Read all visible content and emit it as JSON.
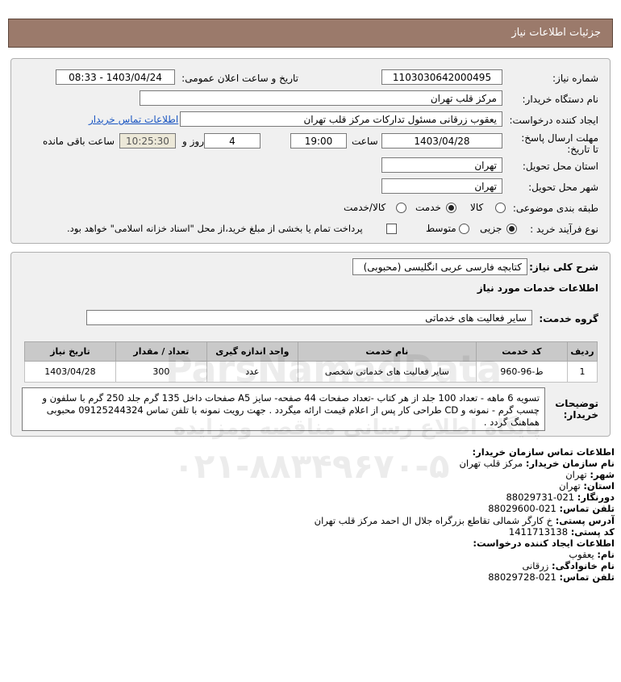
{
  "header": {
    "title": "جزئیات اطلاعات نیاز"
  },
  "need_number": {
    "label": "شماره نیاز:",
    "value": "1103030642000495"
  },
  "announce": {
    "label": "تاریخ و ساعت اعلان عمومی:",
    "value": "1403/04/24 - 08:33"
  },
  "buyer_org": {
    "label": "نام دستگاه خریدار:",
    "value": "مرکز قلب تهران"
  },
  "creator": {
    "label": "ایجاد کننده درخواست:",
    "value": "یعقوب زرقانی مسئول تدارکات مرکز قلب تهران",
    "contact_link": "اطلاعات تماس خریدار"
  },
  "deadline": {
    "label": "مهلت ارسال پاسخ: تا تاریخ:",
    "date": "1403/04/28",
    "time_label": "ساعت",
    "time": "19:00",
    "days": "4",
    "days_label": "روز و",
    "remaining_time": "10:25:30",
    "remaining_label": "ساعت باقی مانده"
  },
  "province": {
    "label": "استان محل تحویل:",
    "value": "تهران"
  },
  "city": {
    "label": "شهر محل تحویل:",
    "value": "تهران"
  },
  "category": {
    "label": "طبقه بندی موضوعی:",
    "options": [
      "کالا",
      "خدمت",
      "کالا/خدمت"
    ],
    "selected": "خدمت"
  },
  "process": {
    "label": "نوع فرآیند خرید :",
    "options": [
      "جزیی",
      "متوسط"
    ],
    "selected": "جزیی",
    "note": "پرداخت تمام یا بخشی از مبلغ خرید،از محل \"اسناد خزانه اسلامی\" خواهد بود."
  },
  "summary": {
    "label": "شرح کلی نیاز:",
    "value": "کتابچه فارسی عربی انگلیسی (محبوبی)"
  },
  "services_title": "اطلاعات خدمات مورد نیاز",
  "service_group": {
    "label": "گروه خدمت:",
    "value": "سایر فعالیت های خدماتی"
  },
  "table": {
    "headers": [
      "ردیف",
      "کد خدمت",
      "نام خدمت",
      "واحد اندازه گیری",
      "تعداد / مقدار",
      "تاریخ نیاز"
    ],
    "rows": [
      [
        "1",
        "ط-96-960",
        "سایر فعالیت های خدماتی شخصی",
        "عدد",
        "300",
        "1403/04/28"
      ]
    ]
  },
  "notes": {
    "label": "توضیحات خریدار:",
    "value": "تسویه 6 ماهه - تعداد 100 جلد از هر کتاب -تعداد صفحات 44 صفحه- سایز A5 صفحات داخل 135 گرم جلد 250 گرم با سلفون و چسب گرم - نمونه و CD طراحی کار پس از اعلام قیمت ارائه میگردد . جهت رویت نمونه با تلفن تماس 09125244324 محبوبی هماهنگ گردد ."
  },
  "contact": {
    "title": "اطلاعات تماس سازمان خریدار:",
    "org_label": "نام سازمان خریدار:",
    "org": "مرکز قلب تهران",
    "city_label": "شهر:",
    "city": "تهران",
    "province_label": "استان:",
    "province": "تهران",
    "fax_label": "دورنگار:",
    "fax": "021-88029731",
    "phone_label": "تلفن تماس:",
    "phone": "021-88029600",
    "address_label": "آدرس پستی:",
    "address": "خ کارگر شمالی تقاطع بزرگراه جلال ال احمد مرکز قلب تهران",
    "postal_label": "کد پستی:",
    "postal": "1411713138",
    "creator_title": "اطلاعات ایجاد کننده درخواست:",
    "first_label": "نام:",
    "first": "یعقوب",
    "last_label": "نام خانوادگی:",
    "last": "زرقانی",
    "cphone_label": "تلفن تماس:",
    "cphone": "021-88029728"
  },
  "watermark": {
    "brand": "ParsNamadData",
    "tagline": "پایگاه اطلاع رسانی مناقصه ومزایده",
    "phone": "۰۲۱-۸۸۳۴۹۶۷۰-۵"
  }
}
